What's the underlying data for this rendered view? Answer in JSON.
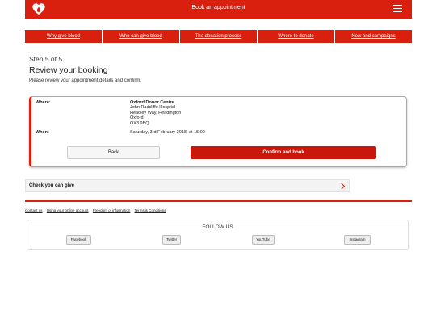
{
  "header": {
    "title": "Book an appointment",
    "logo_icon": "heart-drop-logo-icon",
    "menu_icon": "hamburger-menu-icon",
    "brand_color": "#d91f0e"
  },
  "nav": {
    "items": [
      {
        "label": "Why give blood"
      },
      {
        "label": "Who can give blood"
      },
      {
        "label": "The donation process"
      },
      {
        "label": "Where to donate"
      },
      {
        "label": "New and campaigns"
      }
    ]
  },
  "main": {
    "step": "Step 5 of 5",
    "heading": "Review your booking",
    "intro": "Please review your appointment details and confirm."
  },
  "booking": {
    "where_label": "Where:",
    "centre": "Oxford Donor Centre",
    "address": [
      "John Radcliffe Hospital",
      "Headley Way, Headington",
      "Oxford",
      "OX3 9BQ"
    ],
    "when_label": "When:",
    "when": "Saturday, 3rd February 2018, at 15:00",
    "back_label": "Back",
    "confirm_label": "Confirm and book"
  },
  "check": {
    "label": "Check you can give",
    "icon": "chevron-right-icon"
  },
  "footer": {
    "links": [
      "Contact us",
      "Using your online account",
      "Freedom of information",
      "Terms & Conditions"
    ],
    "follow_title": "FOLLOW US",
    "social": [
      "Facebook",
      "Twitter",
      "YouTube",
      "Instagram"
    ]
  }
}
